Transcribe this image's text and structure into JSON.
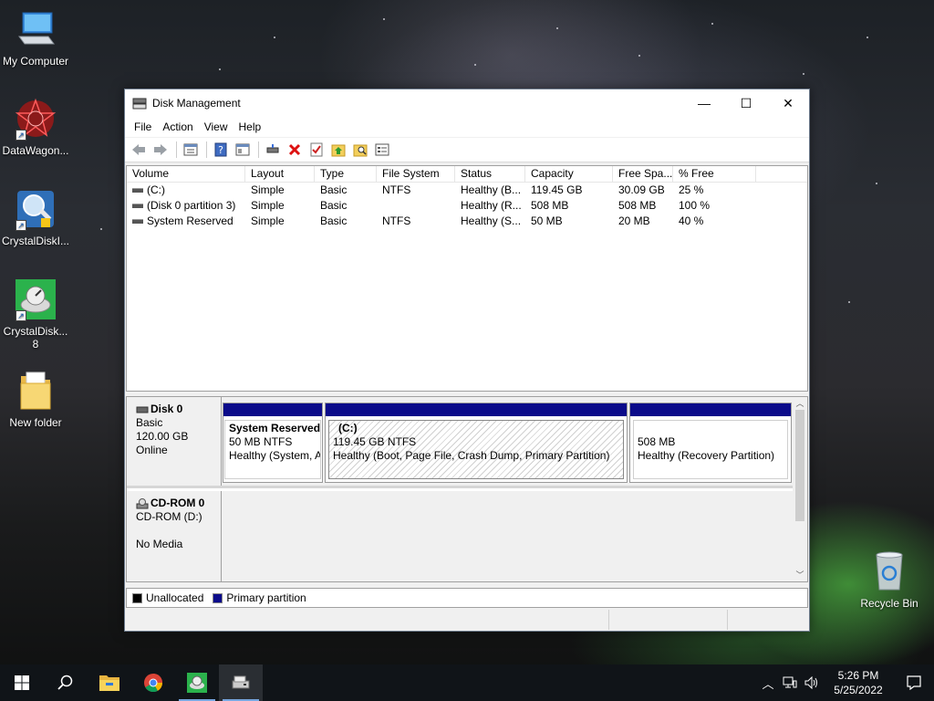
{
  "desktop": {
    "icons": [
      {
        "label": "My Computer",
        "icon": "computer-icon"
      },
      {
        "label": "DataWagon...",
        "icon": "datawagon-icon"
      },
      {
        "label": "CrystalDiskI...",
        "icon": "crystaldiskinfo-icon"
      },
      {
        "label": "CrystalDisk...",
        "label2": "8",
        "icon": "crystaldiskmark-icon"
      },
      {
        "label": "New folder",
        "icon": "folder-icon"
      },
      {
        "label": "Recycle Bin",
        "icon": "recycle-bin-icon"
      }
    ]
  },
  "window": {
    "title": "Disk Management",
    "controls": {
      "minimize": "—",
      "maximize": "☐",
      "close": "✕"
    }
  },
  "menu": [
    "File",
    "Action",
    "View",
    "Help"
  ],
  "toolbar": {
    "icons": [
      "back-icon",
      "forward-icon",
      "properties-list-icon",
      "help-icon",
      "console-view-icon",
      "connect-disk-icon",
      "delete-icon",
      "check-icon",
      "folder-up-icon",
      "search-folder-icon",
      "view-icon"
    ]
  },
  "volumes": {
    "columns": [
      "Volume",
      "Layout",
      "Type",
      "File System",
      "Status",
      "Capacity",
      "Free Spa...",
      "% Free"
    ],
    "rows": [
      [
        "(C:)",
        "Simple",
        "Basic",
        "NTFS",
        "Healthy (B...",
        "119.45 GB",
        "30.09 GB",
        "25 %"
      ],
      [
        "(Disk 0 partition 3)",
        "Simple",
        "Basic",
        "",
        "Healthy (R...",
        "508 MB",
        "508 MB",
        "100 %"
      ],
      [
        "System Reserved",
        "Simple",
        "Basic",
        "NTFS",
        "Healthy (S...",
        "50 MB",
        "20 MB",
        "40 %"
      ]
    ]
  },
  "disks": {
    "disk0": {
      "name": "Disk 0",
      "type": "Basic",
      "size": "120.00 GB",
      "state": "Online",
      "partitions": [
        {
          "name": "System Reserved",
          "size": "50 MB NTFS",
          "status": "Healthy (System, A"
        },
        {
          "name": "(C:)",
          "size": "119.45 GB NTFS",
          "status": "Healthy (Boot, Page File, Crash Dump, Primary Partition)"
        },
        {
          "name": "",
          "size": "508 MB",
          "status": "Healthy (Recovery Partition)"
        }
      ]
    },
    "cdrom0": {
      "name": "CD-ROM 0",
      "type": "CD-ROM (D:)",
      "state": "No Media"
    }
  },
  "legend": {
    "items": [
      {
        "label": "Unallocated",
        "color": "#000000"
      },
      {
        "label": "Primary partition",
        "color": "#0b0b8a"
      }
    ]
  },
  "taskbar": {
    "apps": [
      "windows-start-icon",
      "search-icon",
      "file-explorer-icon",
      "chrome-icon",
      "crystaldiskinfo-icon",
      "disk-management-icon"
    ],
    "time": "5:26 PM",
    "date": "5/25/2022"
  }
}
